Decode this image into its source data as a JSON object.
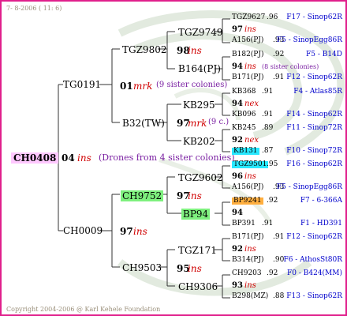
{
  "header": "7- 8-2006 ( 11: 6)",
  "footer": "Copyright 2004-2006 @ Karl Kehele Foundation",
  "root": {
    "id": "CH0408",
    "gen": "04",
    "mark": "ins",
    "note": "(Drones from 4 sister colonies)"
  },
  "sire": {
    "id": "TG0191",
    "sire": {
      "id": "TGZ9802",
      "gen": "01",
      "mark": "mrk",
      "note": "(9 sister colonies)",
      "sire": {
        "id": "TGZ9749",
        "gen": "98",
        "mark": "ins",
        "ancestors": [
          {
            "name": "TGZ9627",
            "val": ".96",
            "place": "F17 - Sinop62R"
          },
          {
            "name": "97",
            "mark": "ins"
          },
          {
            "name": "A156(PJ)",
            "val": ".93",
            "place": "F5 - SinopEgg86R"
          }
        ]
      },
      "dam": {
        "id": "B164(PJ)",
        "ancestors": [
          {
            "name": "B182(PJ)",
            "val": ".92",
            "place": "F5 - B14D"
          },
          {
            "name": "94",
            "mark": "ins",
            "note": "(8 sister colonies)"
          },
          {
            "name": "B171(PJ)",
            "val": ".91",
            "place": "F12 - Sinop62R"
          }
        ]
      }
    },
    "dam": {
      "id": "B32(TW)",
      "gen": "97",
      "mark": "mrk",
      "note": "(9 c.)",
      "sire": {
        "id": "KB295",
        "ancestors": [
          {
            "name": "KB368",
            "val": ".91",
            "place": "F4 - Atlas85R"
          },
          {
            "name": "94",
            "mark": "nex"
          },
          {
            "name": "KB096",
            "val": ".91",
            "place": "F14 - Sinop62R"
          }
        ]
      },
      "dam": {
        "id": "KB202",
        "ancestors": [
          {
            "name": "KB245",
            "val": ".89",
            "place": "F11 - Sinop72R"
          },
          {
            "name": "92",
            "mark": "nex"
          },
          {
            "name": "KB131",
            "val": ".87",
            "place": "F10 - Sinop72R"
          }
        ]
      }
    }
  },
  "dam": {
    "id": "CH0009",
    "sire": {
      "id": "CH9752",
      "gen": "97",
      "mark": "ins",
      "sire": {
        "id": "TGZ9602",
        "ancestors": [
          {
            "name": "TGZ9501",
            "val": ".95",
            "place": "F16 - Sinop62R"
          },
          {
            "name": "96",
            "mark": "ins"
          },
          {
            "name": "A156(PJ)",
            "val": ".93",
            "place": "F5 - SinopEgg86R"
          }
        ]
      },
      "dam": {
        "id": "BP94",
        "ancestors": [
          {
            "name": "BP9241",
            "val": ".92",
            "place": "F7 - 6-366A"
          },
          {
            "name": "94",
            "mark": ""
          },
          {
            "name": "BP391",
            "val": ".91",
            "place": "F1 - HD391"
          }
        ]
      }
    },
    "dam": {
      "id": "CH9503",
      "gen": "00",
      "mark": "ins",
      "sire": {
        "id": "TGZ171",
        "gen": "95",
        "mark": "ins",
        "ancestors": [
          {
            "name": "B171(PJ)",
            "val": ".91",
            "place": "F12 - Sinop62R"
          },
          {
            "name": "92",
            "mark": "ins"
          },
          {
            "name": "B314(PJ)",
            "val": ".90",
            "place": "F6 - AthosSt80R"
          }
        ]
      },
      "dam": {
        "id": "CH9306",
        "ancestors": [
          {
            "name": "CH9203",
            "val": ".92",
            "place": "F0 - B424(MM)"
          },
          {
            "name": "93",
            "mark": "ins"
          },
          {
            "name": "B298(MZ)",
            "val": ".88",
            "place": "F13 - Sinop62R"
          }
        ]
      }
    }
  },
  "colors": {
    "border": "#e0208c",
    "highlight_root": "#ffc8ff",
    "highlight_green": "#7ef07e",
    "highlight_cyan": "#28e8ff",
    "highlight_orange": "#ffaf40",
    "mark_red": "#d00000",
    "place_blue": "#0000cc",
    "note_purple": "#7a1fa2"
  }
}
